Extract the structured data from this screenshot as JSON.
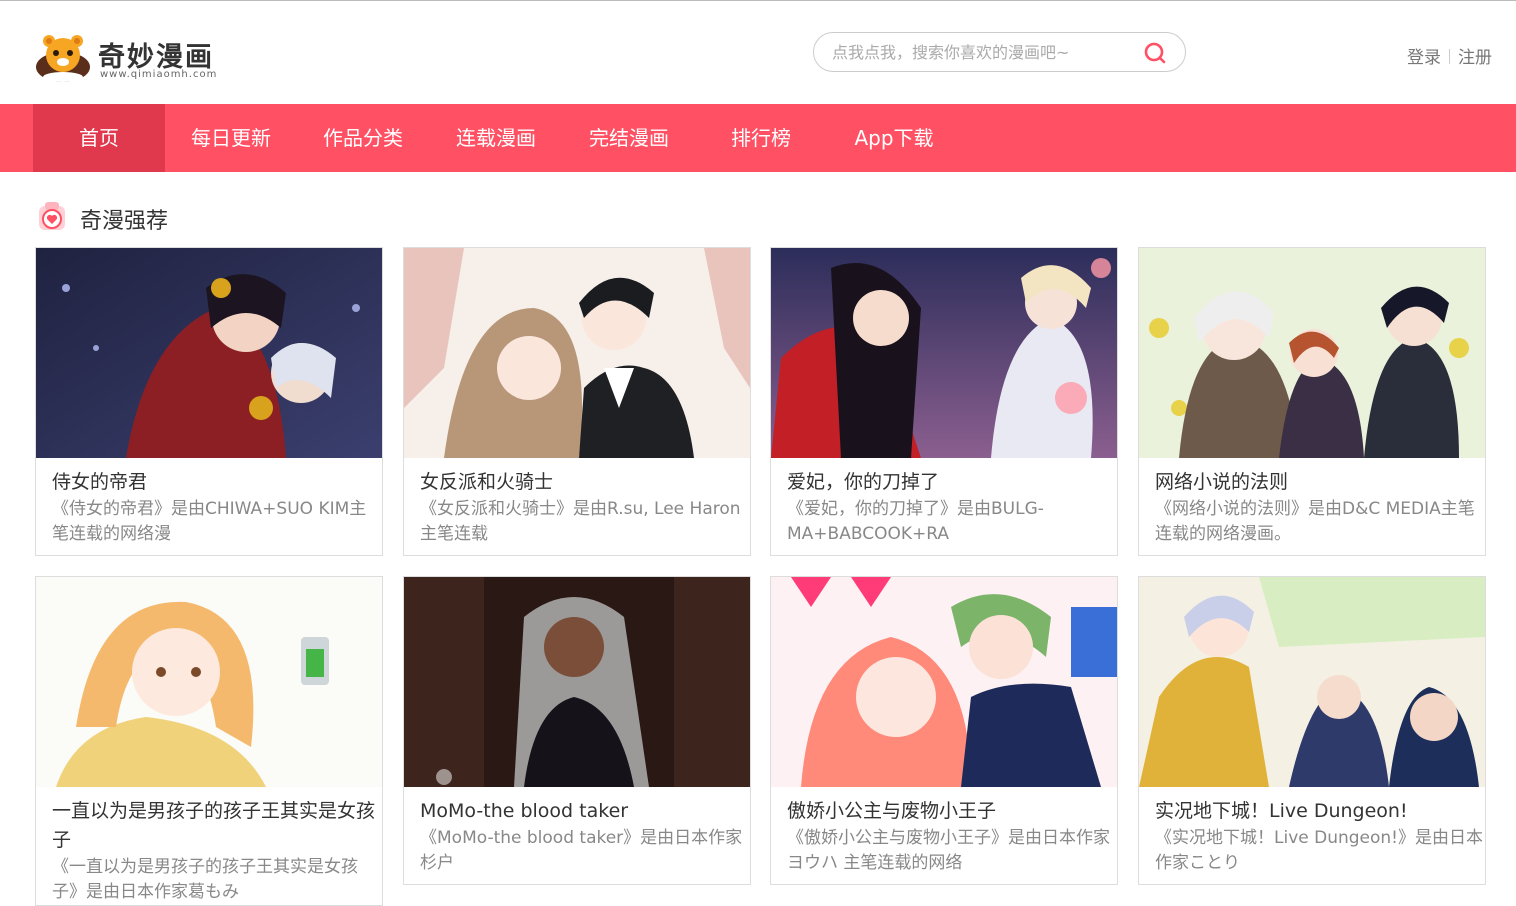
{
  "header": {
    "logo_text": "奇妙漫画",
    "logo_url": "www.qimiaomh.com",
    "search_placeholder": "点我点我，搜索你喜欢的漫画吧~",
    "login_label": "登录",
    "register_label": "注册"
  },
  "nav": {
    "items": [
      {
        "label": "首页"
      },
      {
        "label": "每日更新"
      },
      {
        "label": "作品分类"
      },
      {
        "label": "连载漫画"
      },
      {
        "label": "完结漫画"
      },
      {
        "label": "排行榜"
      },
      {
        "label": "App下载"
      }
    ]
  },
  "section": {
    "title": "奇漫强荐"
  },
  "cards": [
    {
      "title": "侍女的帝君",
      "desc": "《侍女的帝君》是由CHIWA+SUO KIM主笔连载的网络漫"
    },
    {
      "title": "女反派和火骑士",
      "desc": "《女反派和火骑士》是由R.su, Lee Haron主笔连载"
    },
    {
      "title": "爱妃，你的刀掉了",
      "desc": "《爱妃，你的刀掉了》是由BULG-MA+BABCOOK+RA"
    },
    {
      "title": "网络小说的法则",
      "desc": "《网络小说的法则》是由D&C MEDIA主笔连载的网络漫画。"
    },
    {
      "title": "一直以为是男孩子的孩子王其实是女孩子",
      "desc": "《一直以为是男孩子的孩子王其实是女孩子》是由日本作家葛もみ"
    },
    {
      "title": "MoMo-the blood taker",
      "desc": "《MoMo-the blood taker》是由日本作家杉户"
    },
    {
      "title": "傲娇小公主与废物小王子",
      "desc": "《傲娇小公主与废物小王子》是由日本作家ヨウハ 主笔连载的网络"
    },
    {
      "title": "实况地下城！Live Dungeon!",
      "desc": "《实况地下城！Live Dungeon!》是由日本作家ことり"
    }
  ],
  "colors": {
    "nav_bg": "#ff5064",
    "nav_active": "#e0384c",
    "accent": "#ff5064"
  }
}
